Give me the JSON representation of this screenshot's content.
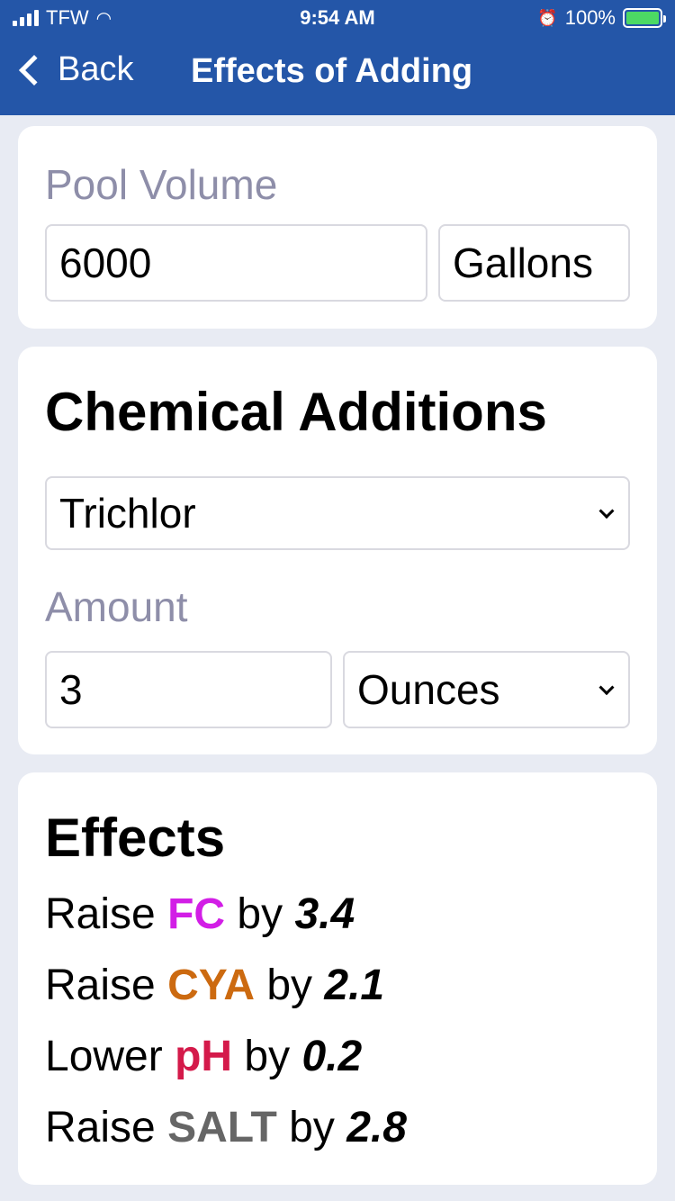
{
  "status": {
    "carrier": "TFW",
    "time": "9:54 AM",
    "battery": "100%"
  },
  "nav": {
    "back_label": "Back",
    "title": "Effects of Adding"
  },
  "pool": {
    "label": "Pool Volume",
    "volume": "6000",
    "unit": "Gallons"
  },
  "chem": {
    "title": "Chemical Additions",
    "chemical": "Trichlor",
    "amount_label": "Amount",
    "amount": "3",
    "amount_unit": "Ounces"
  },
  "effects": {
    "title": "Effects",
    "items": [
      {
        "verb": "Raise",
        "metric": "FC",
        "by": "by",
        "value": "3.4",
        "color": "#d21ee6"
      },
      {
        "verb": "Raise",
        "metric": "CYA",
        "by": "by",
        "value": "2.1",
        "color": "#cc6a10"
      },
      {
        "verb": "Lower",
        "metric": "pH",
        "by": "by",
        "value": "0.2",
        "color": "#d41a4a"
      },
      {
        "verb": "Raise",
        "metric": "SALT",
        "by": "by",
        "value": "2.8",
        "color": "#666666"
      }
    ]
  }
}
